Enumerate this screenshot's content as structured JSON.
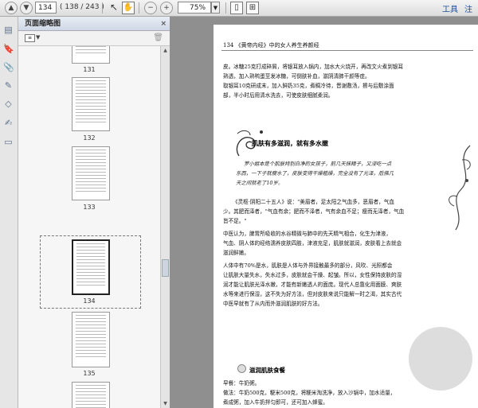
{
  "toolbar": {
    "page_number": "134",
    "page_count": "( 138 / 243 )",
    "zoom": "75%",
    "tools_label": "工具",
    "sign_label": "注"
  },
  "sidebar": {
    "panel_title": "页面缩略图",
    "close_glyph": "×",
    "thumbnails": [
      {
        "label": "131"
      },
      {
        "label": "132"
      },
      {
        "label": "133"
      },
      {
        "label": "134"
      },
      {
        "label": "135"
      }
    ]
  },
  "document": {
    "header": "134 《黄帝内经》中的女人养生养颜经",
    "lines_top": [
      "皮。冰糖25克打成碎屑，将银耳放入锅内，加水大火烧开，再改文火煮到银耳",
      "熟透，加入熟鸭蛋至发冰糖，可倒肤补血，滋阴清肺干颜等症。",
      "    取银耳10克研成末，加入鲜奶35克，煮稠冷待，晋谢敷汤，擦与后敷涂面",
      "部，半小时后用清水洗去，可使皮肤细腻柔润。"
    ],
    "section_title": "肌肤有多滋润，就有多水嫩",
    "quote_lines": [
      "罗小姐本是个肌肤特别白净的女孩子，前几天抹精子，又浸吃一点",
      "东西，一下子就瘦水了，皮肤变得干燥粗燥，完全没有了光泽，后佛几",
      "天之间就老了10岁。"
    ],
    "lines_mid": [
      "《灵枢·阴阳二十五人》说：\"美眉者，足太阳之气血多，恶眉者，气血",
      "少。其肥而泽者，\"气血有余；肥而不泽者，气有余血不足；瘦而无泽者，气血",
      "皆不足。\"",
      "    中医认为，脾胃所吸收的水谷精微与肺中的先天精气相合，化生为津液，",
      "气血、阴人体的经络濡养皮肤四肢，津液充足，肌肤就滋润，皮肤看上去就会",
      "滋润鲜嫩。",
      "    人体中有70%是水，肌肤是人体与外界接触最多的部分，风吹、光照都会",
      "让肌肤大量失水，失水过多，皮肤就会干燥、起皱。所以，女性保持皮肤的湿",
      "润才能让肌肤光泽水嫩，才能有新嫩透人的面庞。现代人总靠化用面膜、爽肤",
      "水等来进行保湿，这不失为好方法，但对皮肤来说只能解一时之渴，其实古代",
      "中医早就有了从内而外滋润肌肤的好方法。"
    ],
    "sub_title": "滋润肌肤食餐",
    "lines_bottom": [
      "    早餐：牛奶粥。",
      "    做法：牛奶500克，粳米500克，将粳米淘洗净，放入沙锅中，加水适量，",
      "煮成粥，加入牛奶拌匀即可，还可加入蜂蜜。"
    ]
  }
}
